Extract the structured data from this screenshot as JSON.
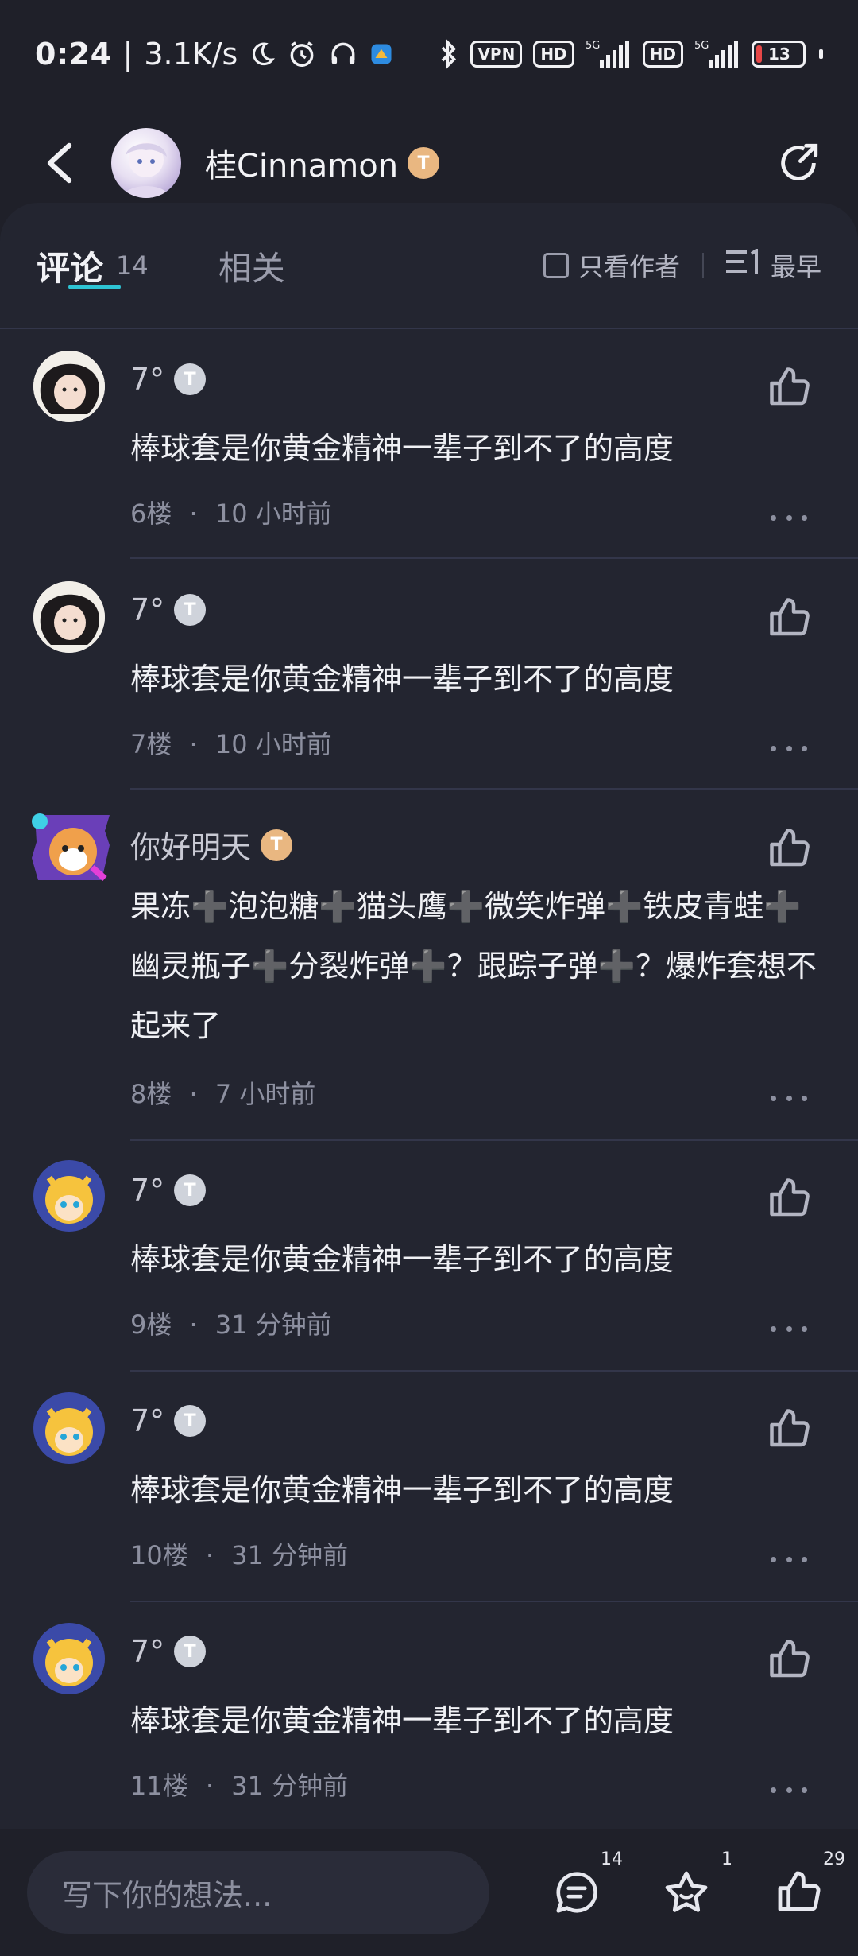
{
  "status_bar": {
    "time": "0:24",
    "speed": "3.1K/s",
    "vpn": "VPN",
    "hd": "HD",
    "net": "5G",
    "battery": "13"
  },
  "header": {
    "owner_name": "桂Cinnamon",
    "owner_tag": "T"
  },
  "tabs": {
    "comments_label": "评论",
    "comments_count": "14",
    "related_label": "相关",
    "author_only": "只看作者",
    "sort_label": "最早"
  },
  "comments": [
    {
      "name": "7°",
      "tag": "T",
      "text": "棒球套是你黄金精神一辈子到不了的高度",
      "floor": "6楼",
      "time": "10 小时前"
    },
    {
      "name": "7°",
      "tag": "T",
      "text": "棒球套是你黄金精神一辈子到不了的高度",
      "floor": "7楼",
      "time": "10 小时前"
    },
    {
      "name": "你好明天",
      "tag": "T",
      "text": "果冻➕泡泡糖➕猫头鹰➕微笑炸弹➕铁皮青蛙➕幽灵瓶子➕分裂炸弹➕？跟踪子弹➕？爆炸套想不起来了",
      "floor": "8楼",
      "time": "7 小时前"
    },
    {
      "name": "7°",
      "tag": "T",
      "text": "棒球套是你黄金精神一辈子到不了的高度",
      "floor": "9楼",
      "time": "31 分钟前"
    },
    {
      "name": "7°",
      "tag": "T",
      "text": "棒球套是你黄金精神一辈子到不了的高度",
      "floor": "10楼",
      "time": "31 分钟前"
    },
    {
      "name": "7°",
      "tag": "T",
      "text": "棒球套是你黄金精神一辈子到不了的高度",
      "floor": "11楼",
      "time": "31 分钟前"
    }
  ],
  "meta_separator": "·",
  "bottom_bar": {
    "placeholder": "写下你的想法...",
    "comment_count": "14",
    "favorite_count": "1",
    "like_count": "29"
  }
}
